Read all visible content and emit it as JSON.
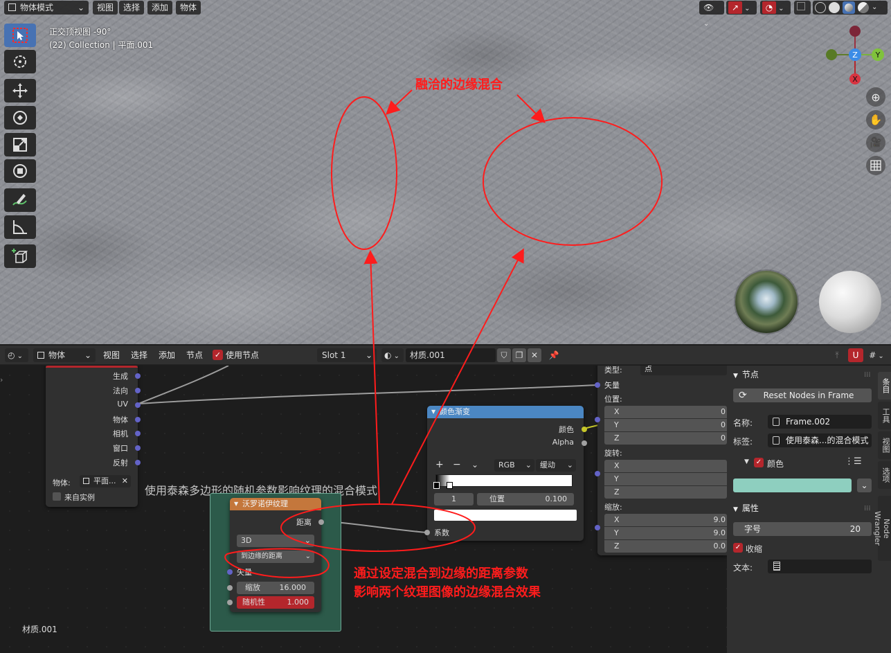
{
  "viewport": {
    "mode_select": "物体模式",
    "menu": [
      "视图",
      "选择",
      "添加",
      "物体"
    ],
    "view_name": "正交顶视图 -90°",
    "collection_info": "(22) Collection | 平面.001",
    "gizmo_axes": {
      "z": "Z",
      "y": "Y",
      "x": "X"
    }
  },
  "node_header": {
    "editor_type": "物体",
    "menu": [
      "视图",
      "选择",
      "添加",
      "节点"
    ],
    "use_nodes_label": "使用节点",
    "slot": "Slot 1",
    "material": "材质.001"
  },
  "nodes": {
    "texcoord": {
      "outputs": [
        "生成",
        "法向",
        "UV",
        "物体",
        "相机",
        "窗口",
        "反射"
      ],
      "object_label": "物体:",
      "object_value": "平面...",
      "from_instancer": "来自实例"
    },
    "frame_label": "使用泰森多边形的随机参数影响纹理的混合模式",
    "voronoi": {
      "title": "沃罗诺伊纹理",
      "output": "距离",
      "dimension": "3D",
      "feature": "到边缘的距离",
      "vector": "矢量",
      "scale_label": "缩放",
      "scale_value": "16.000",
      "random_label": "随机性",
      "random_value": "1.000"
    },
    "color_ramp": {
      "title": "颜色渐变",
      "out_color": "颜色",
      "out_alpha": "Alpha",
      "color_mode": "RGB",
      "interpolation": "缓动",
      "stop_index": "1",
      "position_label": "位置",
      "position_value": "0.100",
      "factor_label": "系数"
    },
    "mapping": {
      "type_label": "类型:",
      "type_value": "点",
      "vector": "矢量",
      "location": "位置:",
      "rotation": "旋转:",
      "scale": "缩放:",
      "axes": [
        "X",
        "Y",
        "Z"
      ],
      "location_values": [
        "0",
        "0",
        "0"
      ],
      "scale_values": [
        "9.0",
        "9.0",
        "0.0"
      ]
    },
    "material_label": "材质.001"
  },
  "sidebar": {
    "node_section": "节点",
    "reset_button": "Reset Nodes in Frame",
    "name_label": "名称:",
    "name_value": "Frame.002",
    "label_label": "标签:",
    "label_value": "使用泰森...的混合模式",
    "color_label": "颜色",
    "color_swatch": "#8ecfbf",
    "properties_section": "属性",
    "font_size_label": "字号",
    "font_size_value": "20",
    "shrink_label": "收缩",
    "text_label": "文本:",
    "tabs": [
      "条目",
      "工具",
      "视图",
      "选项",
      "Node Wrangler"
    ]
  },
  "annotations": {
    "top": "融洽的边缘混合",
    "bottom_line1": "通过设定混合到边缘的距离参数",
    "bottom_line2": "影响两个纹理图像的边缘混合效果"
  },
  "colors": {
    "annotation_red": "#ff1c1c",
    "voronoi_header": "#c4773c",
    "colorramp_header": "#4b87c3",
    "frame_green": "#2c5a4a",
    "accent_blue": "#4772b3"
  }
}
